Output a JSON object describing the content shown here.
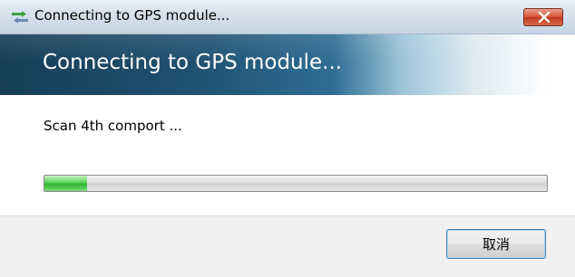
{
  "window": {
    "title": "Connecting to GPS module...",
    "close_icon": "close-icon"
  },
  "banner": {
    "title": "Connecting to GPS module..."
  },
  "status": {
    "text": "Scan 4th comport ..."
  },
  "progress": {
    "fraction": 0.085,
    "fill_color": "#3cc03c"
  },
  "footer": {
    "cancel_label": "取消"
  },
  "colors": {
    "banner_dark": "#163e58",
    "close_button": "#c2391e"
  }
}
